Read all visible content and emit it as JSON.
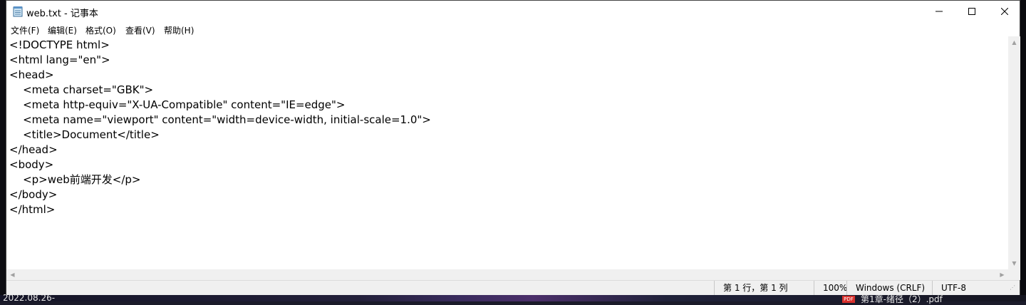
{
  "window": {
    "title": "web.txt - 记事本",
    "icon": "notepad-icon",
    "controls": {
      "minimize": "minimize-icon",
      "maximize": "maximize-icon",
      "close": "close-icon"
    }
  },
  "menu": {
    "file": "文件(F)",
    "edit": "编辑(E)",
    "format": "格式(O)",
    "view": "查看(V)",
    "help": "帮助(H)"
  },
  "editor": {
    "content": "<!DOCTYPE html>\n<html lang=\"en\">\n<head>\n    <meta charset=\"GBK\">\n    <meta http-equiv=\"X-UA-Compatible\" content=\"IE=edge\">\n    <meta name=\"viewport\" content=\"width=device-width, initial-scale=1.0\">\n    <title>Document</title>\n</head>\n<body>\n    <p>web前端开发</p>\n</body>\n</html>"
  },
  "status": {
    "position": "第 1 行，第 1 列",
    "zoom": "100%",
    "line_ending": "Windows (CRLF)",
    "encoding": "UTF-8"
  },
  "desktop": {
    "date_fragment": "2022.08.26-",
    "file_fragment": "第1章-绪径（2）.pdf",
    "pdf_badge": "PDF"
  }
}
